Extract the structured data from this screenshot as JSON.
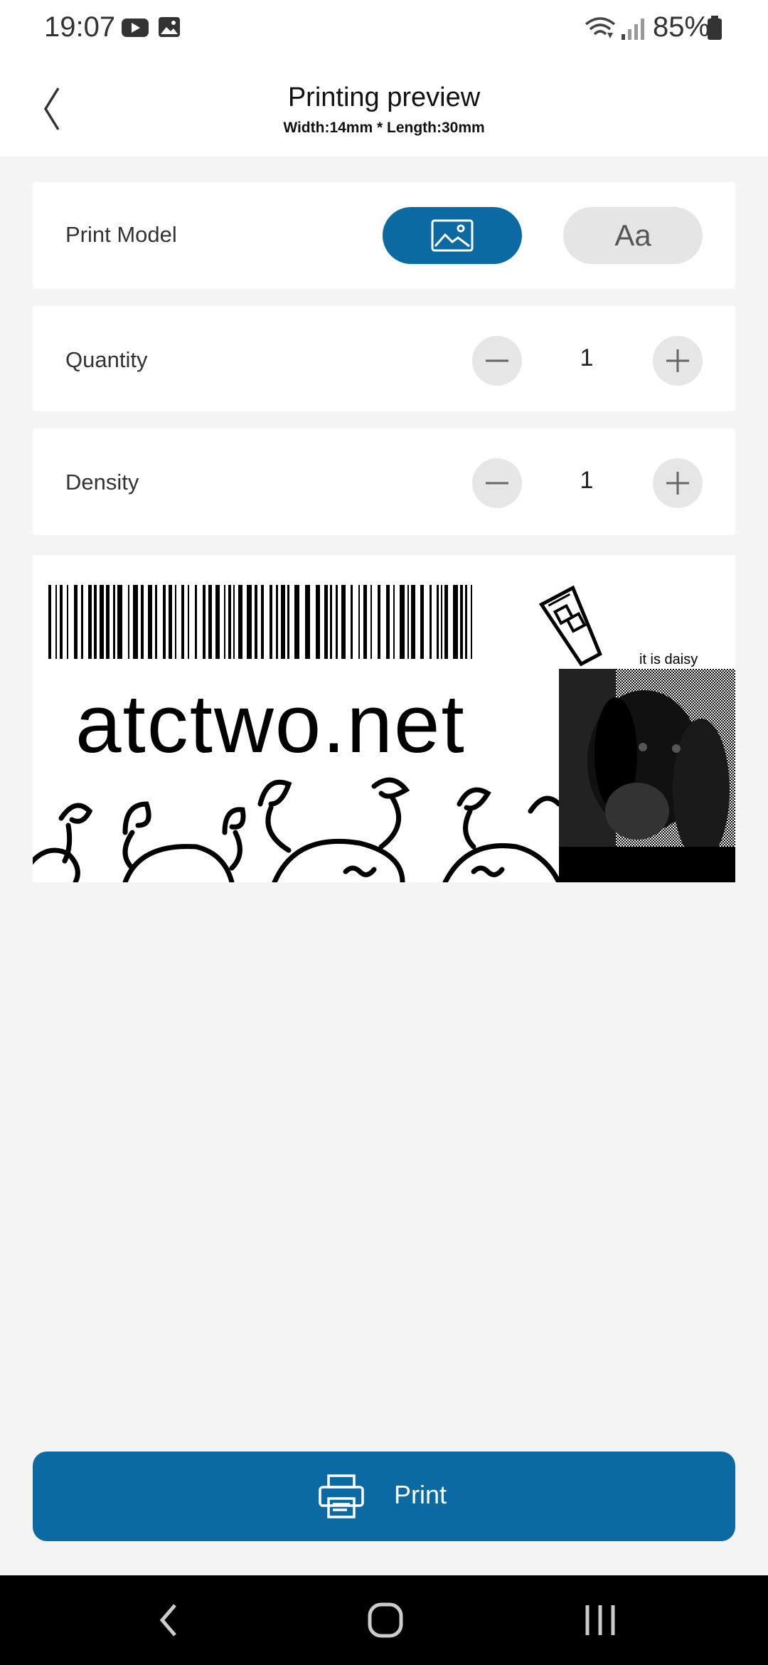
{
  "status_bar": {
    "time": "19:07",
    "battery": "85%",
    "icons": [
      "youtube-icon",
      "gallery-icon",
      "wifi-icon",
      "signal-icon",
      "battery-icon"
    ]
  },
  "header": {
    "title": "Printing preview",
    "subtitle": "Width:14mm * Length:30mm"
  },
  "print_model": {
    "label": "Print Model",
    "text_mode_label": "Aa",
    "selected": "image"
  },
  "quantity": {
    "label": "Quantity",
    "value": "1"
  },
  "density": {
    "label": "Density",
    "value": "1"
  },
  "preview": {
    "main_text": "atctwo.net",
    "caption": "it is daisy"
  },
  "print_button": {
    "label": "Print"
  },
  "colors": {
    "accent": "#0a6aa1",
    "background": "#f4f4f4"
  }
}
